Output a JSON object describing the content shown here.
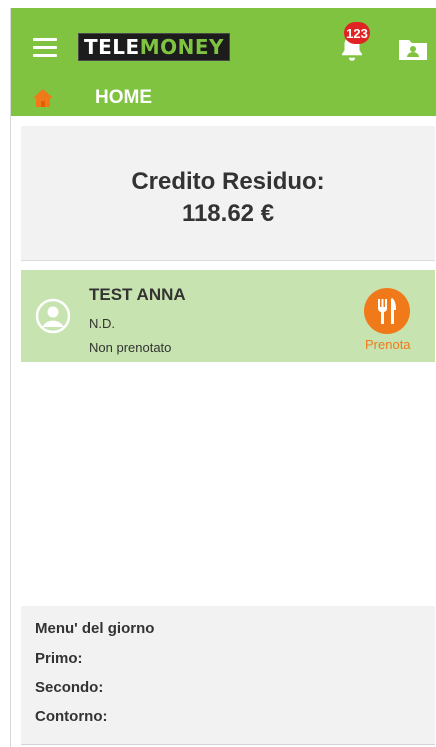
{
  "header": {
    "logo_part1": "TELE",
    "logo_part2": "MONEY",
    "notification_count": "123",
    "icons": {
      "menu": "hamburger-icon",
      "notifications": "bell-icon",
      "contacts": "contact-folder-icon",
      "home": "home-icon"
    },
    "colors": {
      "bar": "#7fc341",
      "accent": "#f07a1a",
      "badge": "#e02424"
    }
  },
  "nav": {
    "home_label": "HOME"
  },
  "credit": {
    "title": "Credito Residuo:",
    "value": "118.62 €"
  },
  "person": {
    "name": "TEST ANNA",
    "code": "N.D.",
    "status": "Non prenotato",
    "action_label": "Prenota",
    "icons": {
      "avatar": "user-avatar-icon",
      "action": "fork-knife-icon"
    }
  },
  "menu": {
    "title": "Menu' del giorno",
    "primo": "Primo:",
    "secondo": "Secondo:",
    "contorno": "Contorno:"
  }
}
